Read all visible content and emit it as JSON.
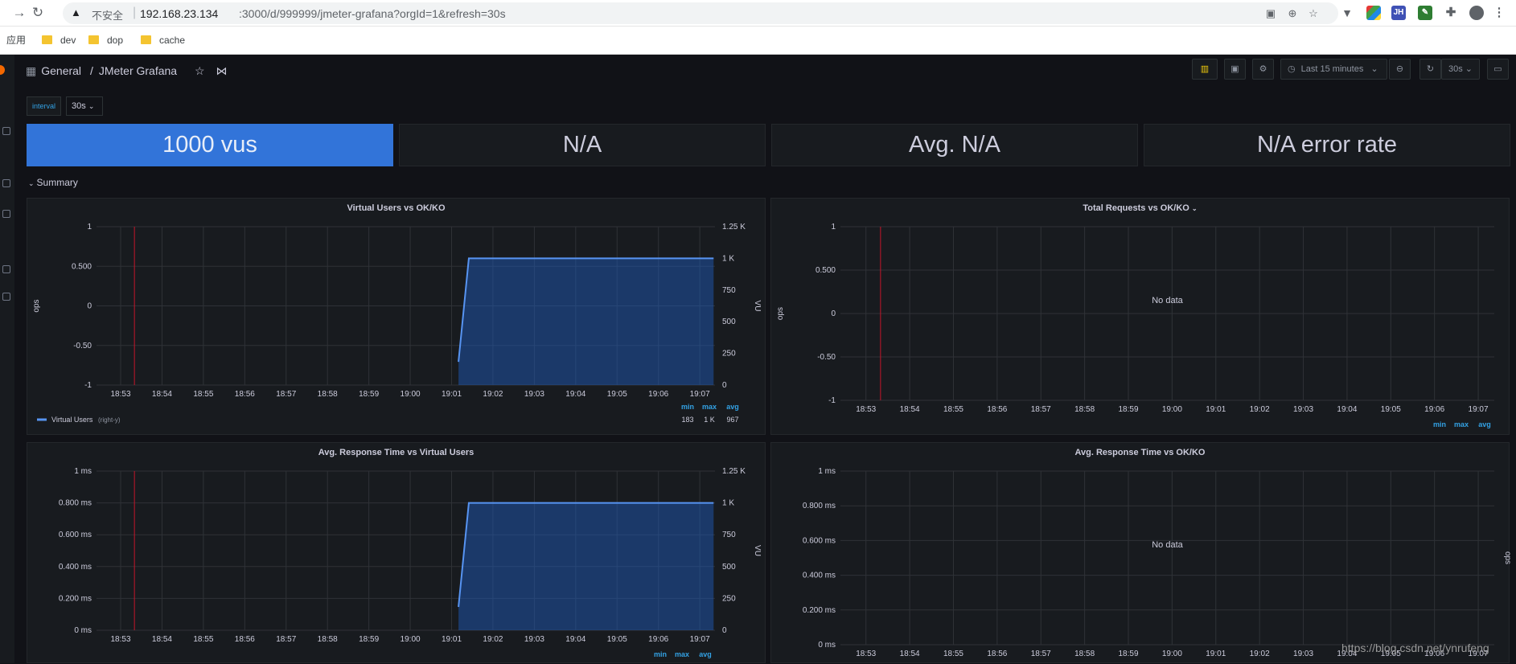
{
  "browser": {
    "security_label": "不安全",
    "url_host": "192.168.23.134",
    "url_path": ":3000/d/999999/jmeter-grafana?orgId=1&refresh=30s",
    "bookmarks": [
      "应用",
      "dev",
      "dop",
      "cache"
    ],
    "extension_badge": "JH"
  },
  "dashboard": {
    "folder": "General",
    "separator": "/",
    "title": "JMeter Grafana",
    "time_range": "Last 15 minutes",
    "refresh": "30s"
  },
  "variables": {
    "interval_label": "interval",
    "interval_value": "30s"
  },
  "stats": [
    "1000 vus",
    "N/A",
    "Avg.   N/A",
    "N/A error rate"
  ],
  "row_title": "Summary",
  "colors": {
    "accent_blue": "#3274d9",
    "series_blue": "#5794f2",
    "panel_bg": "#181b1f",
    "page_bg": "#111217",
    "annotation_red": "#c4162a"
  },
  "time_ticks": [
    "18:53",
    "18:54",
    "18:55",
    "18:56",
    "18:57",
    "18:58",
    "18:59",
    "19:00",
    "19:01",
    "19:02",
    "19:03",
    "19:04",
    "19:05",
    "19:06",
    "19:07"
  ],
  "legend_headers": {
    "min": "min",
    "max": "max",
    "avg": "avg"
  },
  "no_data_label": "No data",
  "watermark": "https://blog.csdn.net/ynrufeng",
  "chart_data": [
    {
      "type": "area",
      "title": "Virtual Users vs OK/KO",
      "ylabel": "ops",
      "y_ticks": [
        "1",
        "0.500",
        "0",
        "-0.50",
        "-1"
      ],
      "ylim": [
        -1,
        1
      ],
      "y2label": "VU",
      "y2_ticks": [
        "1.25 K",
        "1 K",
        "750",
        "500",
        "250",
        "0"
      ],
      "y2lim": [
        0,
        1250
      ],
      "x": [
        "19:01:10",
        "19:01:25",
        "19:07:20"
      ],
      "series": [
        {
          "name": "Virtual Users",
          "axis_note": "(right-y)",
          "values": [
            183,
            1000,
            1000
          ]
        }
      ],
      "legend_stats": {
        "min": "183",
        "max": "1 K",
        "avg": "967"
      },
      "annotation_time": "18:53:20",
      "grid": true
    },
    {
      "type": "line",
      "title": "Total Requests vs OK/KO",
      "ylabel": "ops",
      "y_ticks": [
        "1",
        "0.500",
        "0",
        "-0.50",
        "-1"
      ],
      "ylim": [
        -1,
        1
      ],
      "series": [],
      "no_data": true,
      "annotation_time": "18:53:20",
      "grid": true
    },
    {
      "type": "area",
      "title": "Avg. Response Time vs Virtual Users",
      "y_ticks": [
        "1 ms",
        "0.800 ms",
        "0.600 ms",
        "0.400 ms",
        "0.200 ms",
        "0 ms"
      ],
      "ylim": [
        0,
        1
      ],
      "y2label": "VU",
      "y2_ticks": [
        "1.25 K",
        "1 K",
        "750",
        "500",
        "250",
        "0"
      ],
      "y2lim": [
        0,
        1250
      ],
      "x": [
        "19:01:10",
        "19:01:25",
        "19:07:20"
      ],
      "series": [
        {
          "values": [
            183,
            1000,
            1000
          ]
        }
      ],
      "annotation_time": "18:53:20",
      "grid": true
    },
    {
      "type": "line",
      "title": "Avg. Response Time vs OK/KO",
      "y_ticks": [
        "1 ms",
        "0.800 ms",
        "0.600 ms",
        "0.400 ms",
        "0.200 ms",
        "0 ms"
      ],
      "ylim": [
        0,
        1
      ],
      "y2label": "ops",
      "series": [],
      "no_data": true,
      "grid": true
    }
  ]
}
